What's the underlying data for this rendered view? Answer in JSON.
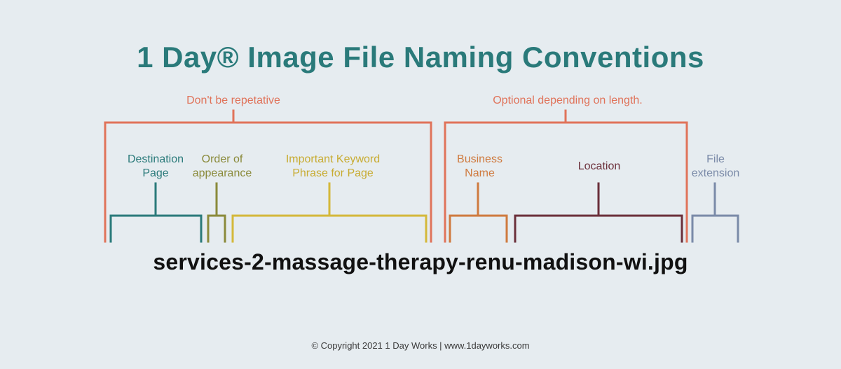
{
  "title": "1 Day® Image File Naming Conventions",
  "top_notes": {
    "left": "Don't be repetative",
    "right": "Optional depending on length."
  },
  "labels": {
    "destination_page": "Destination\nPage",
    "order_of_appearance": "Order of\nappearance",
    "keyword_phrase": "Important Keyword\nPhrase for Page",
    "business_name": "Business\nName",
    "location": "Location",
    "file_extension": "File\nextension"
  },
  "filename": "services-2-massage-therapy-renu-madison-wi.jpg",
  "footer": "© Copyright 2021 1 Day Works   |   www.1dayworks.com",
  "colors": {
    "title": "#2a7a7a",
    "red": "#e0735a",
    "teal": "#2a7a7a",
    "olive": "#8a8a3a",
    "yellow": "#d4b83a",
    "orange": "#cf7a3e",
    "maroon": "#6b2f3a",
    "slate": "#7a8aa8"
  }
}
